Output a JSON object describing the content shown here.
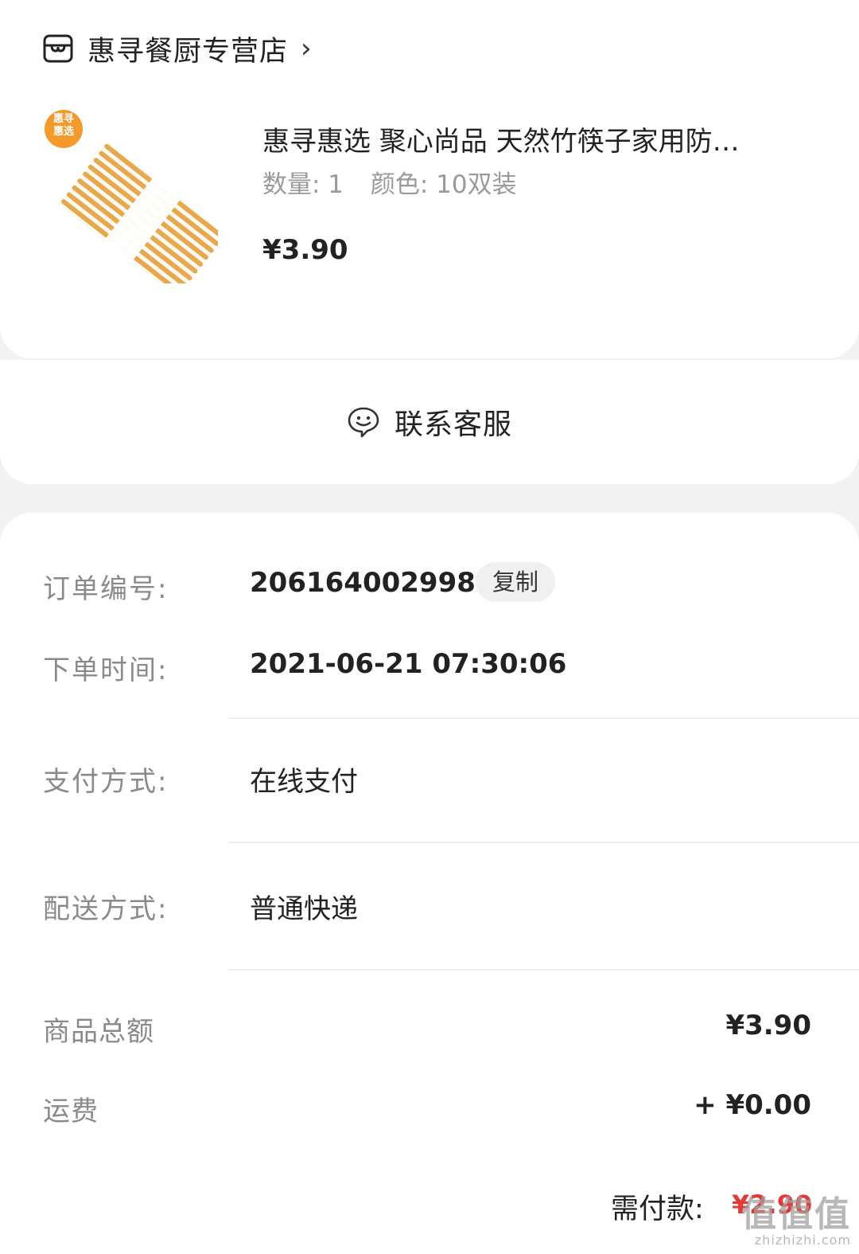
{
  "store": {
    "name": "惠寻餐厨专营店",
    "chevron": "›",
    "icon": "store-icon"
  },
  "product": {
    "badge_line1": "惠寻",
    "badge_line2": "惠选",
    "title": "惠寻惠选 聚心尚品 天然竹筷子家用防…",
    "quantity": "数量: 1",
    "spec": "颜色: 10双装",
    "price": "¥3.90"
  },
  "contact": {
    "label": "联系客服",
    "icon": "chat-icon"
  },
  "order": {
    "number_label": "订单编号:",
    "number": "206164002998",
    "copy_label": "复制",
    "time_label": "下单时间:",
    "time": "2021-06-21 07:30:06",
    "payment_label": "支付方式:",
    "payment": "在线支付",
    "delivery_label": "配送方式:",
    "delivery": "普通快递"
  },
  "summary": {
    "goods_total_label": "商品总额",
    "goods_total": "¥3.90",
    "shipping_label": "运费",
    "shipping": "+ ¥0.00",
    "due_label": "需付款:",
    "due": "¥2.90"
  },
  "watermark": {
    "main": "值值值",
    "sub": "zhizhizhi.com"
  },
  "colors": {
    "accent_red": "#e53935",
    "bamboo": "#e8a94a",
    "badge_orange": "#f39a2b"
  }
}
